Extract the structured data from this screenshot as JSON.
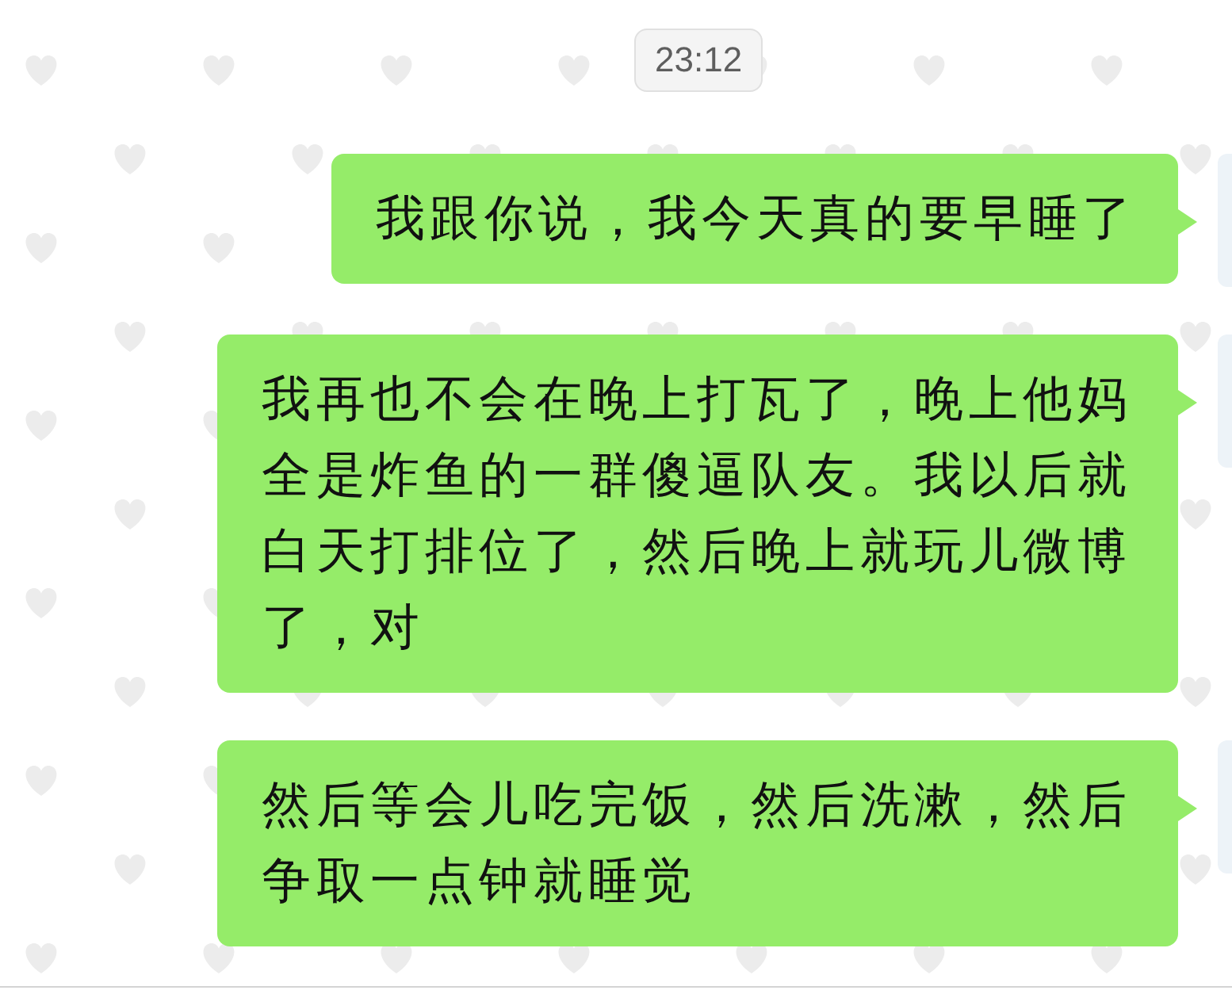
{
  "timestamp": "23:12",
  "messages": [
    {
      "text": "我跟你说，我今天真的要早睡了"
    },
    {
      "text": "我再也不会在晚上打瓦了，晚上他妈全是炸鱼的一群傻逼队友。我以后就白天打排位了，然后晚上就玩儿微博了，对"
    },
    {
      "text": "然后等会儿吃完饭，然后洗漱，然后争取一点钟就睡觉"
    }
  ]
}
